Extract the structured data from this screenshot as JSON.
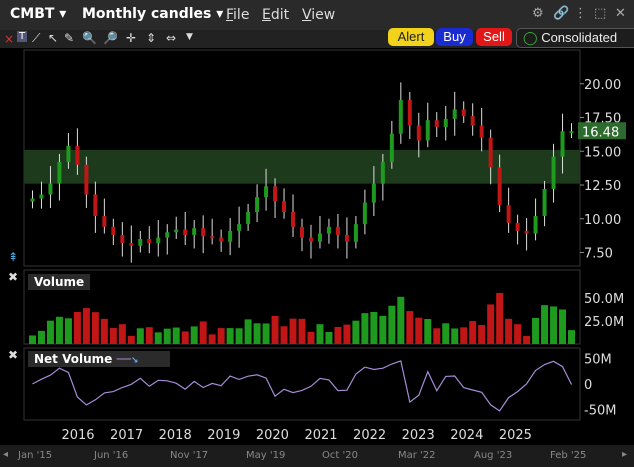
{
  "header": {
    "symbol": "CMBT",
    "period": "Monthly candles",
    "menus": [
      {
        "first": "F",
        "rest": "ile"
      },
      {
        "first": "E",
        "rest": "dit"
      },
      {
        "first": "V",
        "rest": "iew"
      }
    ]
  },
  "actions": {
    "alert": "Alert",
    "buy": "Buy",
    "sell": "Sell",
    "consolidated": "Consolidated"
  },
  "colors": {
    "up": "#1e9a1e",
    "down": "#c01616",
    "netline": "#a58cd6",
    "band": "#1d3a1d",
    "alert": "#f2d21b",
    "buy": "#1a2ccf",
    "sell": "#e21717"
  },
  "price_panel": {
    "last_price": "16.48",
    "yticks": [
      "20.00",
      "17.50",
      "15.00",
      "12.50",
      "10.00",
      "7.50"
    ]
  },
  "volume_panel": {
    "label": "Volume",
    "yticks": [
      "50.0M",
      "25.0M"
    ]
  },
  "net_volume_panel": {
    "label": "Net Volume",
    "yticks": [
      "50M",
      "0",
      "-50M"
    ]
  },
  "x_axis": {
    "years": [
      "2016",
      "2017",
      "2018",
      "2019",
      "2020",
      "2021",
      "2022",
      "2023",
      "2024",
      "2025"
    ]
  },
  "navigator": {
    "labels": [
      "Jan '15",
      "Jun '16",
      "Nov '17",
      "May '19",
      "Oct '20",
      "Mar '22",
      "Aug '23",
      "Feb '25"
    ]
  },
  "chart_data": [
    {
      "type": "candlestick",
      "title": "CMBT Monthly candles",
      "x": [
        "2015-01",
        "2015-03",
        "2015-05",
        "2015-07",
        "2015-09",
        "2015-11",
        "2016-01",
        "2016-03",
        "2016-05",
        "2016-07",
        "2016-09",
        "2016-11",
        "2017-01",
        "2017-03",
        "2017-05",
        "2017-07",
        "2017-09",
        "2017-11",
        "2018-01",
        "2018-03",
        "2018-05",
        "2018-07",
        "2018-09",
        "2018-11",
        "2019-01",
        "2019-03",
        "2019-05",
        "2019-07",
        "2019-09",
        "2019-11",
        "2020-01",
        "2020-03",
        "2020-05",
        "2020-07",
        "2020-09",
        "2020-11",
        "2021-01",
        "2021-03",
        "2021-05",
        "2021-07",
        "2021-09",
        "2021-11",
        "2022-01",
        "2022-03",
        "2022-05",
        "2022-07",
        "2022-09",
        "2022-11",
        "2023-01",
        "2023-03",
        "2023-05",
        "2023-07",
        "2023-09",
        "2023-11",
        "2024-01",
        "2024-03",
        "2024-05",
        "2024-07",
        "2024-09",
        "2024-11",
        "2025-01",
        "2025-03",
        "2025-05",
        "2025-07",
        "2025-09",
        "2025-11",
        "2026-01"
      ],
      "close": [
        11.5,
        11.8,
        12.6,
        14.2,
        15.4,
        14.0,
        11.8,
        10.2,
        9.4,
        8.8,
        8.2,
        8.0,
        8.5,
        8.2,
        8.6,
        9.0,
        9.2,
        8.8,
        9.3,
        8.7,
        8.6,
        8.3,
        9.1,
        9.6,
        10.5,
        11.6,
        12.4,
        11.3,
        10.5,
        9.4,
        8.6,
        8.3,
        8.9,
        9.4,
        8.8,
        8.3,
        9.6,
        11.2,
        12.6,
        14.2,
        16.3,
        18.8,
        16.9,
        15.8,
        17.3,
        16.8,
        17.4,
        18.1,
        17.6,
        16.9,
        16.0,
        13.8,
        11.0,
        9.7,
        9.1,
        8.9,
        10.2,
        12.2,
        14.6,
        16.48,
        16.48
      ],
      "ylim": [
        6.5,
        22.5
      ],
      "last_price": 16.48
    },
    {
      "type": "bar",
      "title": "Volume",
      "ylim": [
        0,
        80
      ]
    },
    {
      "type": "line",
      "title": "Net Volume",
      "ylim": [
        -70,
        70
      ]
    }
  ]
}
